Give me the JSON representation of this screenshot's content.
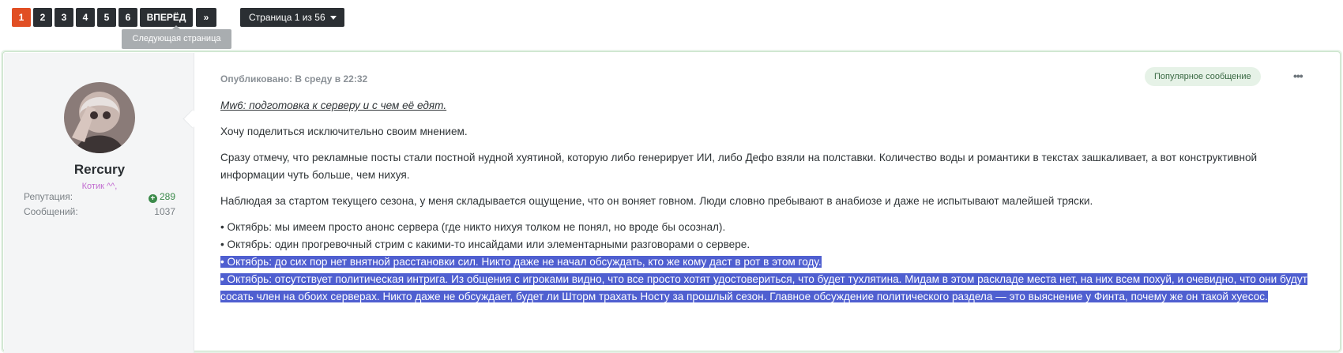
{
  "pagination": {
    "pages": [
      "1",
      "2",
      "3",
      "4",
      "5",
      "6"
    ],
    "next_label": "ВПЕРЁД",
    "last_label": "»",
    "jump_label": "Страница 1 из 56",
    "tooltip": "Следующая страница"
  },
  "author": {
    "name": "Rercury",
    "title": "Котик ^^,",
    "reputation_label": "Репутация:",
    "reputation_value": "289",
    "posts_label": "Сообщений:",
    "posts_value": "1037"
  },
  "post": {
    "meta": "Опубликовано: В среду в 22:32",
    "badge": "Популярное сообщение",
    "title": "Mw6: подготовка к серверу и с чем её едят.",
    "p1": "Хочу поделиться исключительно своим мнением.",
    "p2": "Сразу отмечу, что рекламные посты стали постной нудной хуятиной, которую либо генерирует ИИ, либо Дефо взяли на полставки. Количество воды и романтики в текстах зашкаливает, а вот конструктивной информации чуть больше, чем нихуя.",
    "p3": "Наблюдая за стартом текущего сезона, у меня складывается ощущение, что он воняет говном. Люди словно пребывают в анабиозе и даже не испытывают малейшей тряски.",
    "b1": "• Октябрь: мы имеем просто анонс сервера (где никто нихуя толком не понял, но вроде бы осознал).",
    "b2": "• Октябрь: один прогревочный стрим с какими-то инсайдами или элементарными разговорами о сервере.",
    "b3": "• Октябрь: до сих пор нет внятной расстановки сил. Никто даже не начал обсуждать, кто же кому даст в рот в этом году.",
    "b4": "• Октябрь: отсутствует политическая интрига. Из общения с игроками видно, что все просто хотят удостовериться, что будет тухлятина. Мидам в этом раскладе места нет, на них всем похуй, и очевидно, что они будут сосать член на обоих серверах. Никто даже не обсуждает, будет ли Шторм трахать Носту за прошлый сезон. Главное обсуждение политического раздела — это выяснение у Финта, почему же он такой хуесос."
  },
  "colors": {
    "active_page": "#e14f24",
    "page_button": "#2b2f33",
    "selection": "#4f5fd0",
    "badge_bg": "#e6f2e7"
  }
}
